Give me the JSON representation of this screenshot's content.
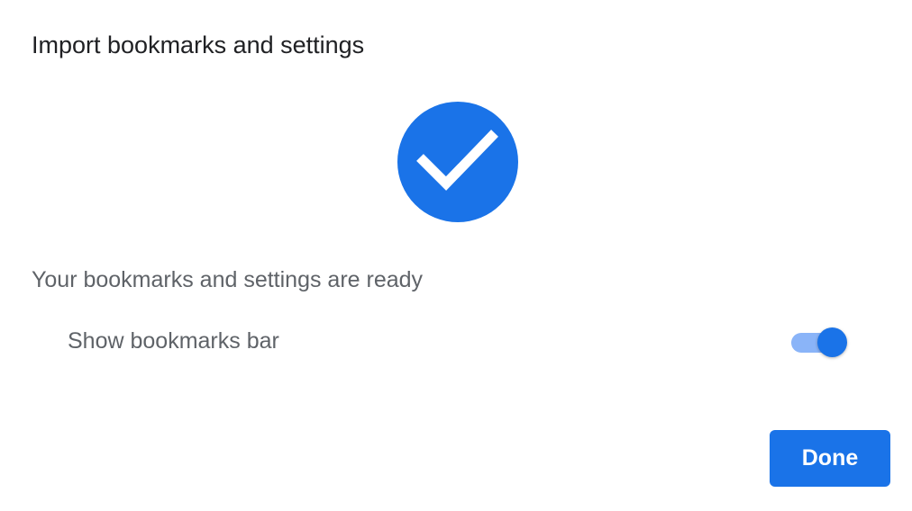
{
  "dialog": {
    "title": "Import bookmarks and settings",
    "status_icon": "checkmark-circle-icon",
    "message": "Your bookmarks and settings are ready",
    "bookmarks_bar_toggle": {
      "label": "Show bookmarks bar",
      "checked": true
    },
    "done_label": "Done"
  },
  "colors": {
    "accent": "#1a73e8",
    "accent_light": "#8ab4f8",
    "title_text": "#202124",
    "secondary_text": "#5f6368",
    "background": "#ffffff"
  }
}
